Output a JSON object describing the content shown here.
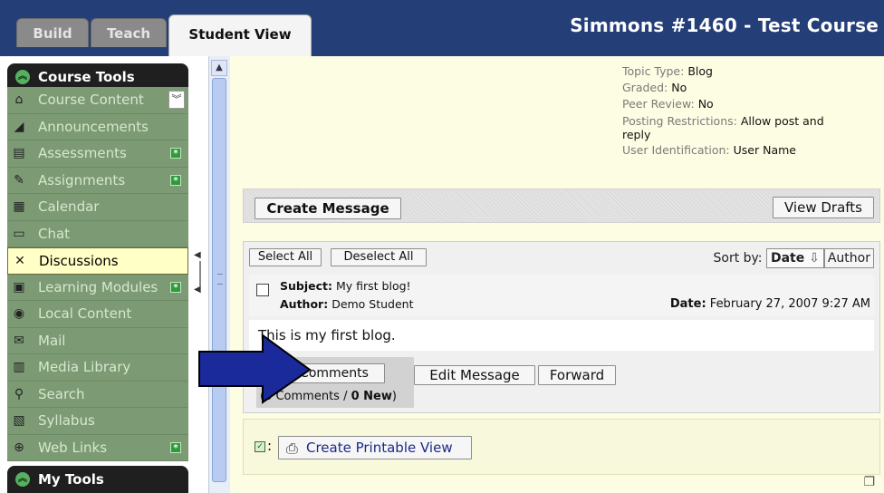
{
  "header": {
    "tabs": [
      {
        "label": "Build"
      },
      {
        "label": "Teach"
      },
      {
        "label": "Student View"
      }
    ],
    "course_title": "Simmons #1460 - Test Course",
    "bg_color": "#243e78"
  },
  "sidebar": {
    "course_tools_label": "Course Tools",
    "my_tools_label": "My Tools",
    "items": [
      {
        "label": "Course Content",
        "icon": "home-icon"
      },
      {
        "label": "Announcements",
        "icon": "megaphone-icon"
      },
      {
        "label": "Assessments",
        "icon": "assessment-icon"
      },
      {
        "label": "Assignments",
        "icon": "assignment-icon"
      },
      {
        "label": "Calendar",
        "icon": "calendar-icon"
      },
      {
        "label": "Chat",
        "icon": "chat-icon"
      },
      {
        "label": "Discussions",
        "icon": "discussion-icon"
      },
      {
        "label": "Learning Modules",
        "icon": "module-icon"
      },
      {
        "label": "Local Content",
        "icon": "disc-icon"
      },
      {
        "label": "Mail",
        "icon": "mail-icon"
      },
      {
        "label": "Media Library",
        "icon": "media-icon"
      },
      {
        "label": "Search",
        "icon": "search-icon"
      },
      {
        "label": "Syllabus",
        "icon": "syllabus-icon"
      },
      {
        "label": "Web Links",
        "icon": "globe-icon"
      }
    ],
    "active_item": "Discussions",
    "accent_color": "#7c9a74"
  },
  "topic_info": {
    "topic_type_label": "Topic Type:",
    "topic_type_value": "Blog",
    "graded_label": "Graded:",
    "graded_value": "No",
    "peer_review_label": "Peer Review:",
    "peer_review_value": "No",
    "posting_label": "Posting Restrictions:",
    "posting_value": "Allow post and reply",
    "user_id_label": "User Identification:",
    "user_id_value": "User Name"
  },
  "actions": {
    "create_message": "Create Message",
    "view_drafts": "View Drafts"
  },
  "message_list": {
    "select_all": "Select All",
    "deselect_all": "Deselect All",
    "sort_by_label": "Sort by:",
    "sort_date": "Date",
    "sort_author": "Author"
  },
  "message": {
    "subject_label": "Subject:",
    "subject": "My first blog!",
    "author_label": "Author:",
    "author": "Demo Student",
    "date_label": "Date:",
    "date": "February 27, 2007 9:27 AM",
    "body": "This is my first blog.",
    "comments_button": "Comments",
    "comments_count_prefix": "(0 Comments / ",
    "comments_new": "0 New",
    "comments_count_suffix": ")",
    "edit_button": "Edit Message",
    "forward_button": "Forward"
  },
  "printable": {
    "label": "Create Printable View"
  }
}
